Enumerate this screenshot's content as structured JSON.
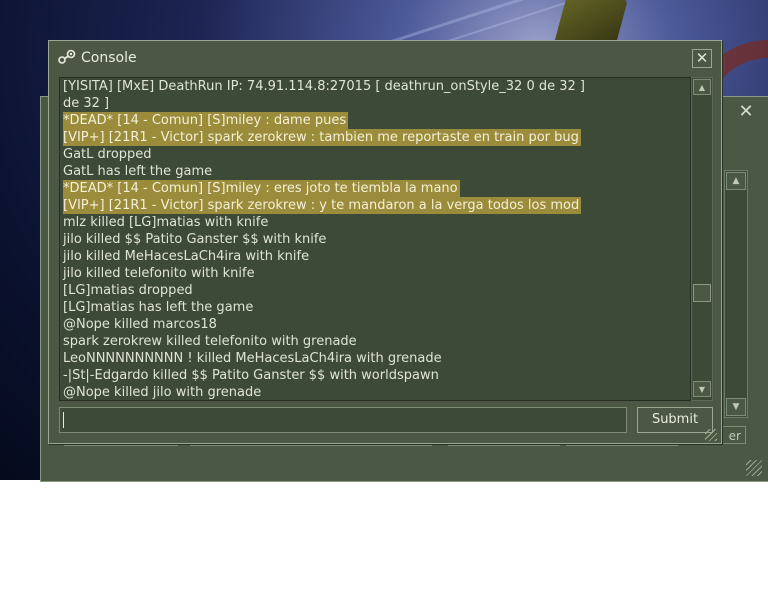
{
  "console": {
    "title": "Console",
    "close_glyph": "✕",
    "submit_label": "Submit",
    "input_value": "",
    "log": [
      {
        "text": "[YISITA] [MxE] DeathRun IP: 74.91.114.8:27015 [ deathrun_onStyle_32 0 de 32 ]",
        "highlight": false
      },
      {
        "text": "de 32 ]",
        "highlight": false
      },
      {
        "text": "*DEAD* [14 - Comun] [S]miley : dame pues",
        "highlight": true
      },
      {
        "text": "[VIP+] [21R1 - Victor] spark zerokrew : tambien me reportaste en train por bug",
        "highlight": true
      },
      {
        "text": "GatL dropped",
        "highlight": false
      },
      {
        "text": "GatL has left the game",
        "highlight": false
      },
      {
        "text": "*DEAD* [14 - Comun] [S]miley : eres joto te tiembla la mano",
        "highlight": true
      },
      {
        "text": "[VIP+] [21R1 - Victor] spark zerokrew : y te mandaron a la verga todos los mod",
        "highlight": true
      },
      {
        "text": "mlz killed [LG]matias with knife",
        "highlight": false
      },
      {
        "text": "jilo killed $$ Patito Ganster $$ with knife",
        "highlight": false
      },
      {
        "text": "jilo killed MeHacesLaCh4ira with knife",
        "highlight": false
      },
      {
        "text": "jilo killed telefonito with knife",
        "highlight": false
      },
      {
        "text": "[LG]matias dropped",
        "highlight": false
      },
      {
        "text": "[LG]matias has left the game",
        "highlight": false
      },
      {
        "text": "@Nope killed marcos18",
        "highlight": false
      },
      {
        "text": "spark zerokrew killed telefonito with grenade",
        "highlight": false
      },
      {
        "text": "LeoNNNNNNNNNN             ! killed MeHacesLaCh4ira with grenade",
        "highlight": false
      },
      {
        "text": "-|St|-Edgardo killed $$ Patito Ganster $$ with worldspawn",
        "highlight": false
      },
      {
        "text": "@Nope killed jilo with grenade",
        "highlight": false
      }
    ]
  },
  "scrollbar": {
    "up_glyph": "▲",
    "down_glyph": "▼"
  },
  "back_window": {
    "close_glyph": "✕",
    "partial_button_text": "er",
    "up_glyph": "▲",
    "down_glyph": "▼"
  },
  "colors": {
    "panel": "#4c5844",
    "highlight": "#9a8c3a",
    "text": "#dfe4d6"
  }
}
